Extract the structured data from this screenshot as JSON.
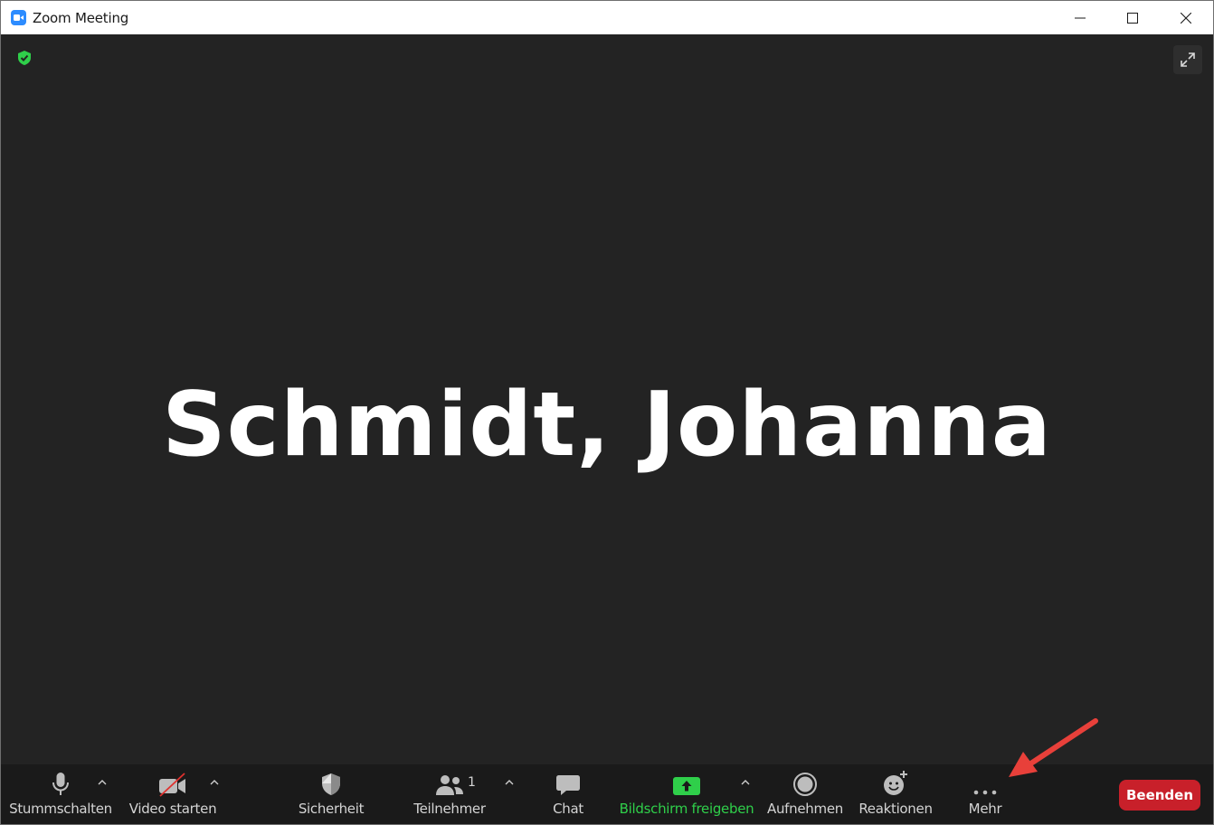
{
  "window": {
    "title": "Zoom Meeting",
    "icon": "zoom-camera-icon",
    "controls": [
      "minimize-icon",
      "maximize-icon",
      "close-icon"
    ]
  },
  "stage": {
    "participant_name": "Schmidt, Johanna",
    "encryption_icon": "shield-check-icon",
    "fullscreen_icon": "expand-icon"
  },
  "toolbar": {
    "mute": {
      "label": "Stummschalten",
      "icon": "microphone-icon"
    },
    "video": {
      "label": "Video starten",
      "icon": "video-off-icon"
    },
    "security": {
      "label": "Sicherheit",
      "icon": "shield-icon"
    },
    "participants": {
      "label": "Teilnehmer",
      "icon": "people-icon",
      "count": "1"
    },
    "chat": {
      "label": "Chat",
      "icon": "chat-bubble-icon"
    },
    "share": {
      "label": "Bildschirm freigeben",
      "icon": "share-screen-icon"
    },
    "record": {
      "label": "Aufnehmen",
      "icon": "record-icon"
    },
    "reactions": {
      "label": "Reaktionen",
      "icon": "smiley-plus-icon"
    },
    "more": {
      "label": "Mehr",
      "icon": "ellipsis-icon"
    },
    "end": {
      "label": "Beenden"
    }
  },
  "colors": {
    "stage_bg": "#232323",
    "toolbar_bg": "#1a1a1a",
    "share_green": "#2fcf4a",
    "end_red": "#c8202a",
    "zoom_blue": "#2d8cff",
    "annotation_red": "#e8403a"
  }
}
